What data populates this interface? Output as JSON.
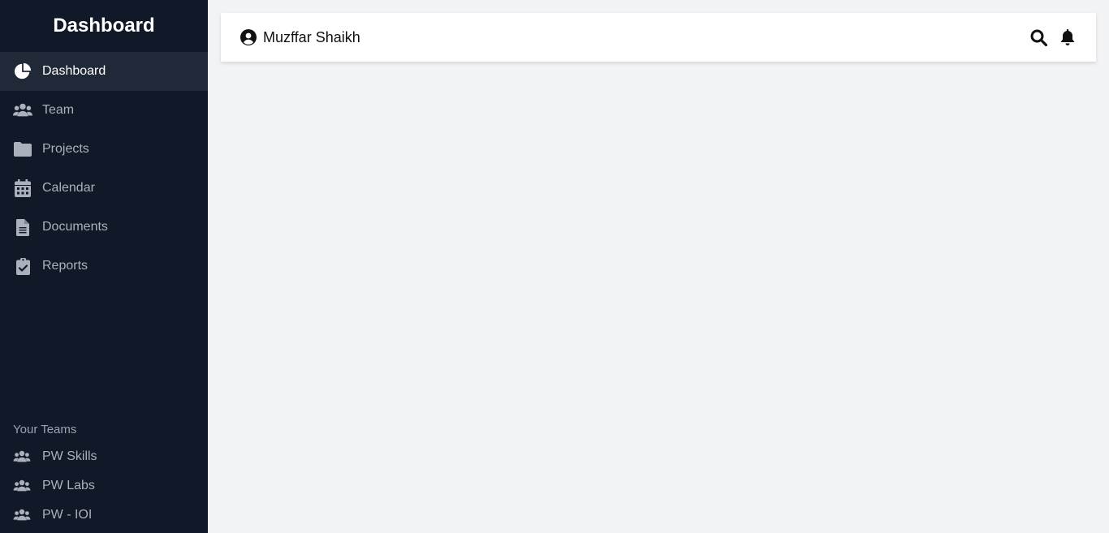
{
  "sidebar": {
    "brand": "Dashboard",
    "items": [
      {
        "label": "Dashboard",
        "icon": "pie-chart-icon",
        "active": true
      },
      {
        "label": "Team",
        "icon": "users-icon"
      },
      {
        "label": "Projects",
        "icon": "folder-icon"
      },
      {
        "label": "Calendar",
        "icon": "calendar-icon"
      },
      {
        "label": "Documents",
        "icon": "document-icon"
      },
      {
        "label": "Reports",
        "icon": "clipboard-check-icon"
      }
    ],
    "teams_title": "Your Teams",
    "teams": [
      {
        "label": "PW Skills",
        "icon": "users-icon"
      },
      {
        "label": "PW Labs",
        "icon": "users-icon"
      },
      {
        "label": "PW - IOI",
        "icon": "users-icon"
      }
    ]
  },
  "header": {
    "user_name": "Muzffar Shaikh",
    "user_icon": "user-circle-icon",
    "search_icon": "search-icon",
    "notification_icon": "bell-icon"
  },
  "colors": {
    "sidebar_bg": "#111827",
    "sidebar_active_bg": "#1f2937",
    "sidebar_text": "#aab1bd",
    "main_bg": "#f2f3f5"
  }
}
